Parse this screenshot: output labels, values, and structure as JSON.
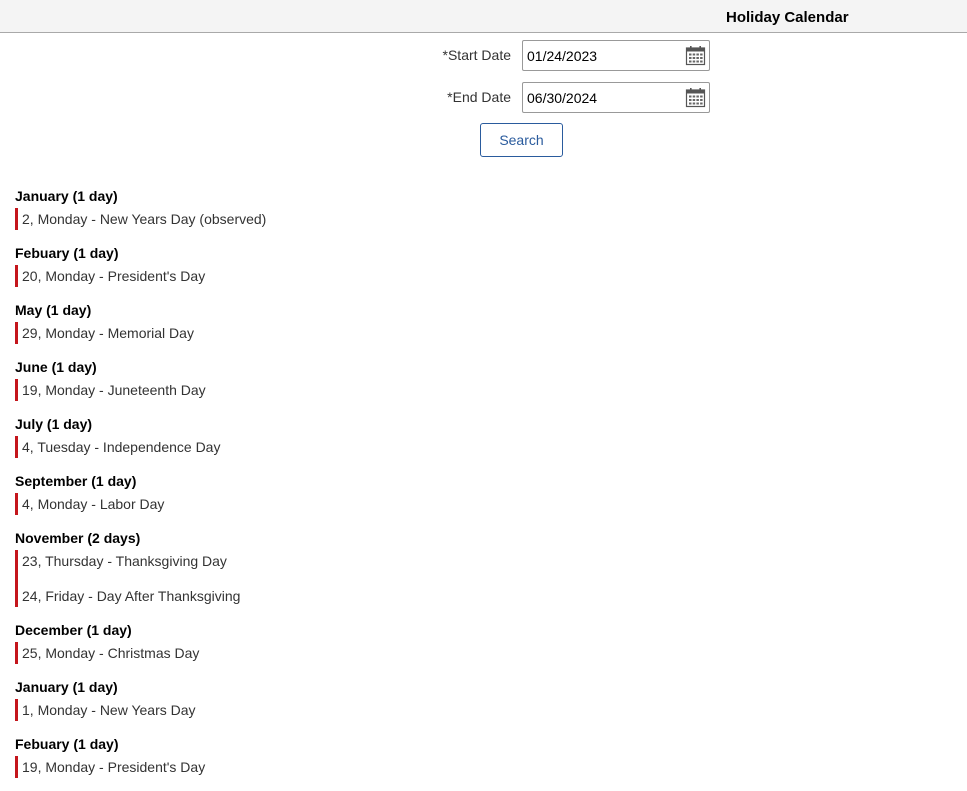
{
  "header": {
    "title": "Holiday Calendar"
  },
  "form": {
    "start_date": {
      "required_mark": "*",
      "label": "Start Date",
      "value": "01/24/2023"
    },
    "end_date": {
      "required_mark": "*",
      "label": "End Date",
      "value": "06/30/2024"
    },
    "search_label": "Search",
    "calendar_icon": "calendar-icon"
  },
  "accent_color": "#c4161c",
  "button_color": "#2a5b9d",
  "months": [
    {
      "heading": "January (1 day)",
      "entries": [
        "2, Monday - New Years Day (observed)"
      ]
    },
    {
      "heading": "Febuary (1 day)",
      "entries": [
        "20, Monday - President's Day"
      ]
    },
    {
      "heading": "May (1 day)",
      "entries": [
        "29, Monday - Memorial Day"
      ]
    },
    {
      "heading": "June (1 day)",
      "entries": [
        "19, Monday - Juneteenth Day"
      ]
    },
    {
      "heading": "July (1 day)",
      "entries": [
        "4, Tuesday - Independence Day"
      ]
    },
    {
      "heading": "September (1 day)",
      "entries": [
        "4, Monday - Labor Day"
      ]
    },
    {
      "heading": "November (2 days)",
      "entries": [
        "23, Thursday - Thanksgiving Day",
        "24, Friday - Day After Thanksgiving"
      ]
    },
    {
      "heading": "December (1 day)",
      "entries": [
        "25, Monday - Christmas Day"
      ]
    },
    {
      "heading": "January (1 day)",
      "entries": [
        "1, Monday - New Years Day"
      ]
    },
    {
      "heading": "Febuary (1 day)",
      "entries": [
        "19, Monday - President's Day"
      ]
    }
  ]
}
